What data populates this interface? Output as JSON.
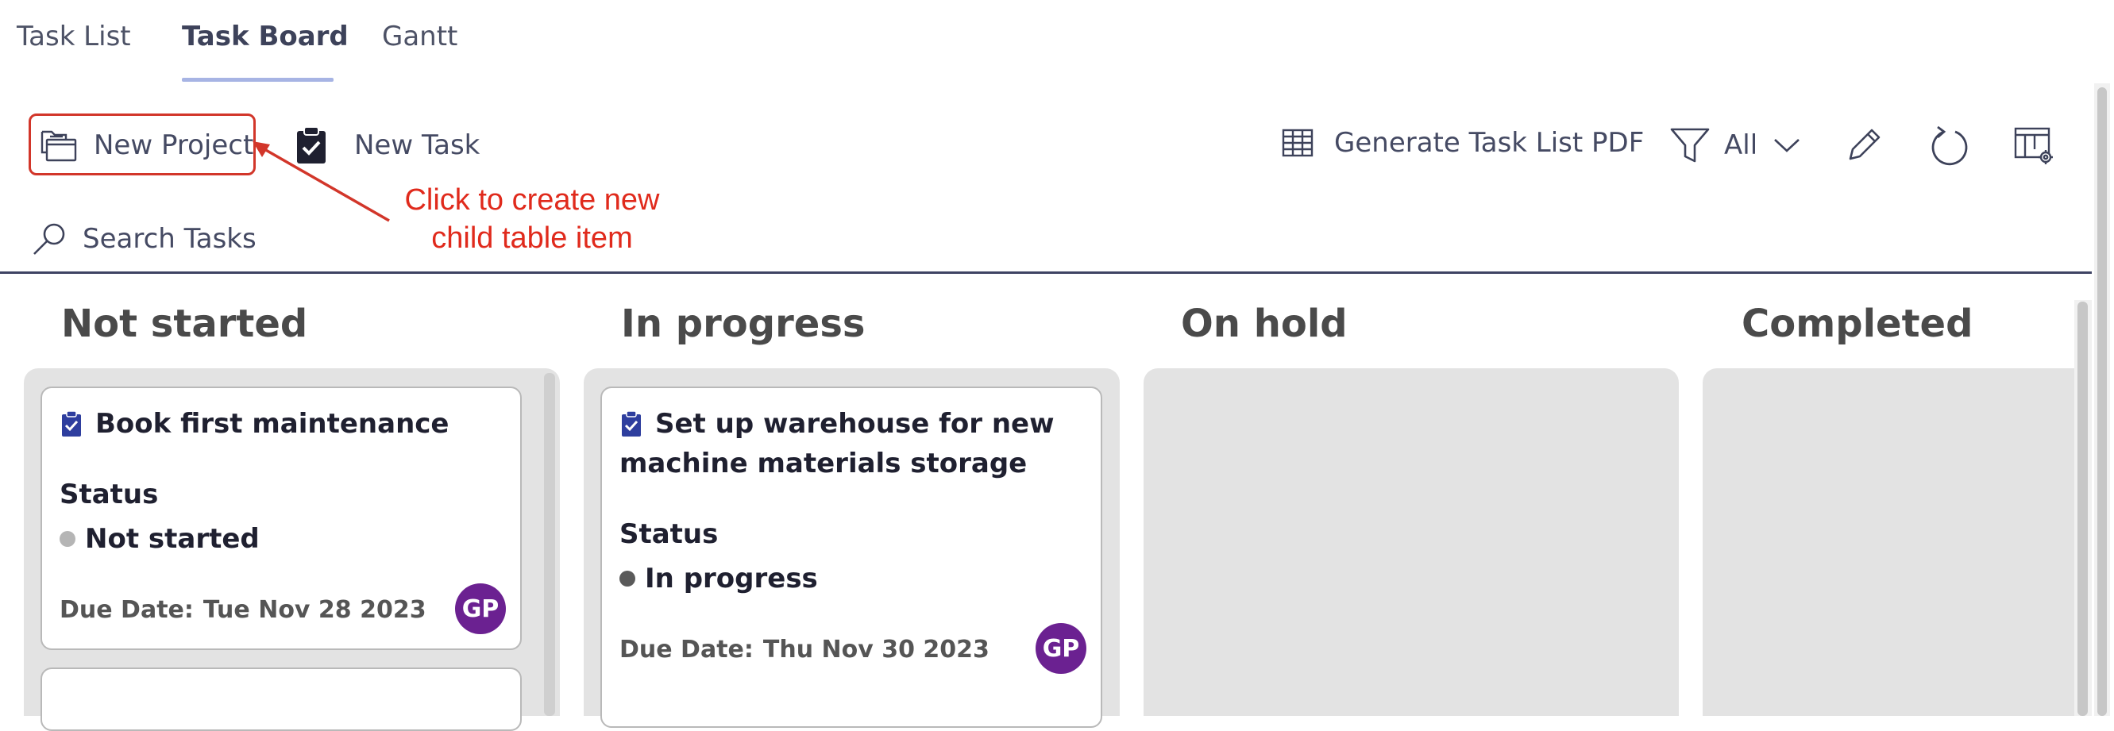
{
  "tabs": [
    {
      "label": "Task List",
      "active": false
    },
    {
      "label": "Task Board",
      "active": true
    },
    {
      "label": "Gantt",
      "active": false
    }
  ],
  "toolbar": {
    "new_project_label": "New Project",
    "new_task_label": "New Task",
    "generate_pdf_label": "Generate Task List PDF",
    "filter_value": "All",
    "search_placeholder": "Search Tasks",
    "icons": [
      "folder-icon",
      "clipboard-check-icon",
      "table-icon",
      "filter-icon",
      "chevron-down-icon",
      "pencil-icon",
      "refresh-icon",
      "table-settings-icon",
      "search-icon"
    ]
  },
  "annotation": {
    "line1": "Click to create new",
    "line2": "child table item",
    "color": "#e02a1c"
  },
  "columns": [
    {
      "title": "Not started",
      "cards": [
        {
          "title": "Book first maintenance",
          "status_label": "Status",
          "status": "Not started",
          "status_color": "#b5b5b5",
          "due_label": "Due Date:",
          "due_date": "Tue Nov 28 2023",
          "assignee_initials": "GP"
        }
      ]
    },
    {
      "title": "In progress",
      "cards": [
        {
          "title_line1": "Set up warehouse for new",
          "title_line2": "machine materials storage",
          "status_label": "Status",
          "status": "In progress",
          "status_color": "#5a5a5a",
          "due_label": "Due Date:",
          "due_date": "Thu Nov 30 2023",
          "assignee_initials": "GP"
        }
      ]
    },
    {
      "title": "On hold",
      "cards": []
    },
    {
      "title": "Completed",
      "cards": []
    }
  ],
  "colors": {
    "accent": "#a7b4e4",
    "avatar": "#6b2191",
    "task_icon": "#2e3e9e",
    "highlight": "#d2362a"
  }
}
